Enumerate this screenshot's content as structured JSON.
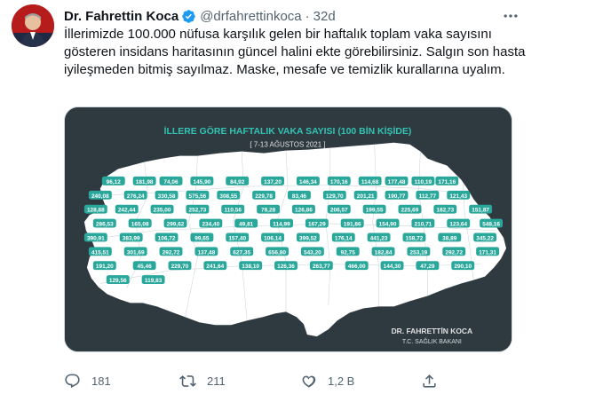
{
  "tweet": {
    "display_name": "Dr. Fahrettin Koca",
    "handle": "@drfahrettinkoca",
    "separator": "·",
    "time": "32d",
    "text": "İllerimizde 100.000 nüfusa karşılık gelen bir haftalık toplam vaka sayısını gösteren insidans haritasının güncel halini ekte görebilirsiniz. Salgın son hasta iyileşmeden bitmiş sayılmaz. Maske, mesafe ve temizlik kurallarına uyalım."
  },
  "media": {
    "map_title": "İLLERE GÖRE HAFTALIK VAKA SAYISI (100 BİN KİŞİDE)",
    "date_range": "[ 7-13 AĞUSTOS 2021 ]",
    "signature_name": "DR. FAHRETTİN KOCA",
    "signature_title": "T.C. SAĞLIK BAKANI",
    "province_values": [
      "96,12",
      "181,98",
      "74,06",
      "145,90",
      "84,92",
      "137,20",
      "146,34",
      "170,16",
      "114,68",
      "177,48",
      "110,19",
      "171,16",
      "240,08",
      "276,24",
      "330,58",
      "575,56",
      "308,55",
      "229,78",
      "83,46",
      "129,70",
      "201,21",
      "190,77",
      "112,77",
      "121,43",
      "128,88",
      "242,44",
      "235,00",
      "252,73",
      "110,56",
      "78,28",
      "126,86",
      "206,57",
      "199,55",
      "225,69",
      "182,73",
      "151,87",
      "286,53",
      "165,08",
      "299,62",
      "234,40",
      "49,81",
      "114,99",
      "167,29",
      "191,86",
      "154,90",
      "210,71",
      "123,64",
      "548,16",
      "390,91",
      "383,99",
      "106,72",
      "99,65",
      "157,40",
      "106,14",
      "399,52",
      "176,14",
      "441,23",
      "158,72",
      "38,89",
      "345,22",
      "415,51",
      "301,69",
      "292,72",
      "137,48",
      "627,35",
      "656,80",
      "543,20",
      "92,75",
      "182,84",
      "253,19",
      "292,72",
      "171,31",
      "191,20",
      "45,46",
      "229,70",
      "241,64",
      "138,10",
      "126,36",
      "263,77",
      "466,00",
      "144,30",
      "47,29",
      "290,10",
      "129,56",
      "119,83"
    ]
  },
  "actions": {
    "reply_count": "181",
    "retweet_count": "211",
    "like_count": "1,2 B"
  },
  "colors": {
    "verified": "#1d9bf0",
    "map_background": "#2f3a40",
    "map_land": "#ffffff",
    "value_badge": "#2aa79b",
    "title_text": "#33c3b3"
  }
}
